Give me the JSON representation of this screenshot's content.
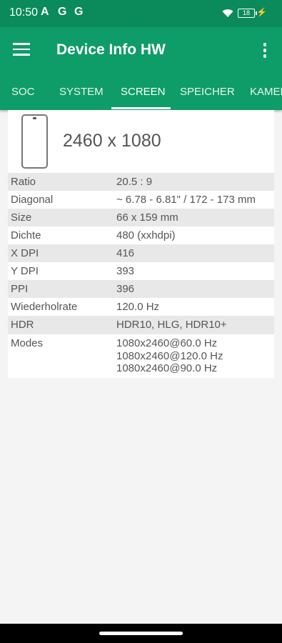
{
  "status_bar": {
    "time": "10:50",
    "notification_icons": [
      "A",
      "G",
      "G"
    ],
    "battery_level": "18"
  },
  "app_bar": {
    "title": "Device Info HW"
  },
  "tabs": [
    "SOC",
    "SYSTEM",
    "SCREEN",
    "SPEICHER",
    "KAMERA"
  ],
  "active_tab": "SCREEN",
  "screen": {
    "resolution": "2460 x 1080",
    "rows": [
      {
        "label": "Ratio",
        "value": "20.5 : 9"
      },
      {
        "label": "Diagonal",
        "value": "~ 6.78 - 6.81\" / 172 - 173 mm"
      },
      {
        "label": "Size",
        "value": "66 x 159 mm"
      },
      {
        "label": "Dichte",
        "value": "480 (xxhdpi)"
      },
      {
        "label": "X DPI",
        "value": "416"
      },
      {
        "label": "Y DPI",
        "value": "393"
      },
      {
        "label": "PPI",
        "value": "396"
      },
      {
        "label": "Wiederholrate",
        "value": "120.0 Hz"
      },
      {
        "label": "HDR",
        "value": "HDR10, HLG, HDR10+"
      }
    ],
    "modes": {
      "label": "Modes",
      "values": [
        "1080x2460@60.0 Hz",
        "1080x2460@120.0 Hz",
        "1080x2460@90.0 Hz"
      ]
    }
  },
  "colors": {
    "status_bar": "#0b8a5c",
    "app_bar": "#0e9c69",
    "row_shade": "#e8e8e8"
  }
}
